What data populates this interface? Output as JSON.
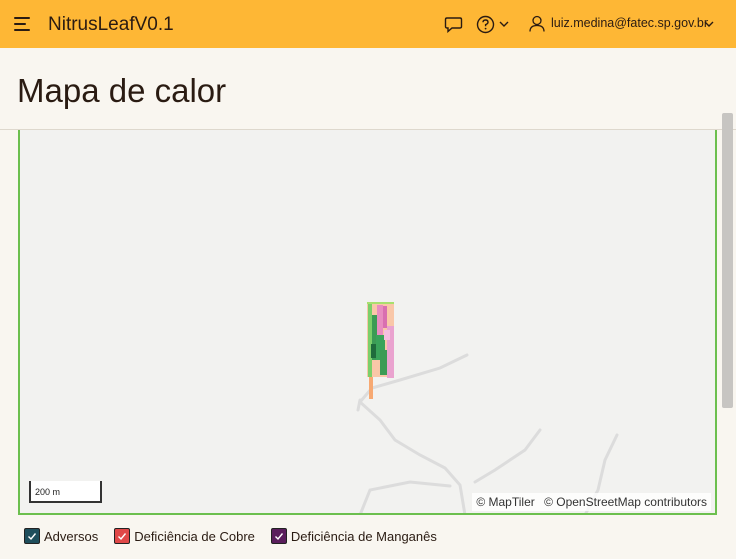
{
  "app": {
    "title": "NitrusLeafV0.1"
  },
  "header": {
    "icons": [
      "menu-icon",
      "chat-icon",
      "help-icon",
      "chevron-down-icon",
      "user-icon"
    ],
    "user_email": "luiz.medina@fatec.sp.gov.br"
  },
  "page": {
    "title": "Mapa de calor"
  },
  "map": {
    "scale_label": "200 m",
    "attribution": [
      "© MapTiler",
      "© OpenStreetMap contributors"
    ]
  },
  "legend": [
    {
      "label": "Adversos",
      "color": "#1f4e5c"
    },
    {
      "label": "Deficiência de Cobre",
      "color": "#e04848"
    },
    {
      "label": "Deficiência de Manganês",
      "color": "#5a1e5c"
    }
  ]
}
